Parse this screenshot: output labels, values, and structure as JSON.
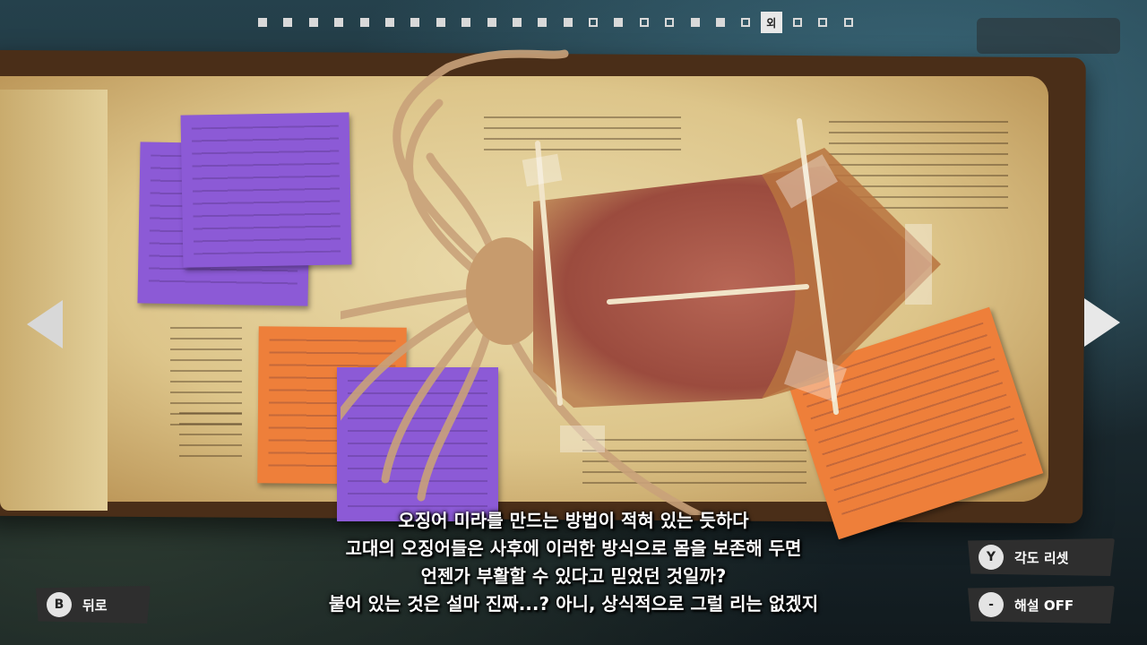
{
  "progress": {
    "dots": [
      "filled",
      "filled",
      "filled",
      "filled",
      "filled",
      "filled",
      "filled",
      "filled",
      "filled",
      "filled",
      "filled",
      "filled",
      "filled",
      "empty",
      "filled",
      "empty",
      "empty",
      "filled",
      "filled",
      "empty",
      "current",
      "empty",
      "empty",
      "empty"
    ],
    "current_label": "외"
  },
  "subtitle": {
    "lines": [
      "오징어 미라를 만드는 방법이 적혀 있는 듯하다",
      "고대의 오징어들은 사후에 이러한 방식으로 몸을 보존해 두면",
      "언젠가 부활할 수 있다고 믿었던 것일까?",
      "붙어 있는 것은 설마 진짜...? 아니, 상식적으로 그럴 리는 없겠지"
    ]
  },
  "buttons": {
    "back": {
      "key": "B",
      "label": "뒤로"
    },
    "reset_angle": {
      "key": "Y",
      "label": "각도 리셋"
    },
    "commentary": {
      "key": "-",
      "label": "해설 OFF"
    }
  },
  "colors": {
    "note_purple": "#8c5ad6",
    "note_orange": "#ee7f3a",
    "paper": "#e2cf99",
    "squid": "#a9574a"
  }
}
